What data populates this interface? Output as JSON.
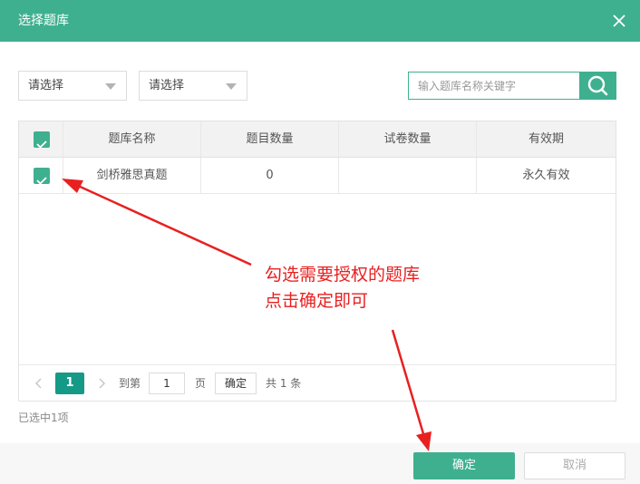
{
  "dialog": {
    "title": "选择题库"
  },
  "filters": {
    "select1_label": "请选择",
    "select2_label": "请选择",
    "search_placeholder": "输入题库名称关键字"
  },
  "table": {
    "headers": [
      "题库名称",
      "题目数量",
      "试卷数量",
      "有效期"
    ],
    "rows": [
      {
        "name": "剑桥雅思真题",
        "question_count": "0",
        "paper_count": "",
        "validity": "永久有效",
        "checked": true
      }
    ]
  },
  "pagination": {
    "current_page": "1",
    "goto_label": "到第",
    "page_input_value": "1",
    "page_unit": "页",
    "confirm_label": "确定",
    "total_text": "共 1 条"
  },
  "selection_info": "已选中1项",
  "footer": {
    "ok_label": "确定",
    "cancel_label": "取消"
  },
  "annotation": {
    "line1": "勾选需要授权的题库",
    "line2": "点击确定即可"
  },
  "colors": {
    "accent": "#3fb08f",
    "page_active": "#159a87",
    "annotation": "#e82020"
  }
}
